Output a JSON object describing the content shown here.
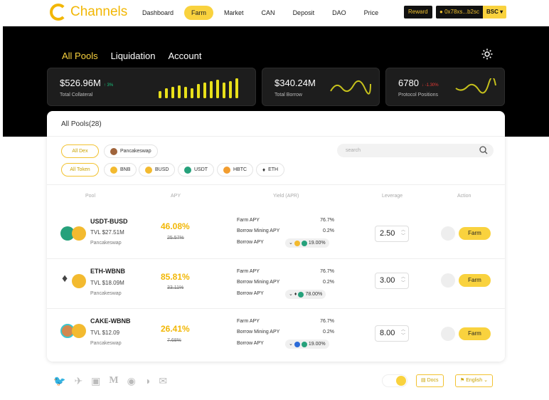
{
  "brand": {
    "name": "Channels"
  },
  "nav": [
    "Dashboard",
    "Farm",
    "Market",
    "CAN",
    "Deposit",
    "DAO",
    "Price"
  ],
  "nav_active": "Farm",
  "header": {
    "reward_label": "Reward",
    "wallet_address": "0x78xs...b2sc",
    "chain": "BSC"
  },
  "tabs": [
    "All Pools",
    "Liquidation",
    "Account"
  ],
  "stats": [
    {
      "value": "$526.96M",
      "label": "Total Collateral",
      "change": "3%",
      "change_dir": "up",
      "color": "#19c37d"
    },
    {
      "value": "$340.24M",
      "label": "Total Borrow"
    },
    {
      "value": "6780",
      "label": "Protocol Positions",
      "change": "-1.30%",
      "change_dir": "down",
      "color": "#e53935"
    }
  ],
  "pools_card": {
    "title": "All Pools(28)"
  },
  "filters": {
    "dex": [
      "All Dex",
      "Pancakeswap"
    ],
    "tokens": [
      "All Token",
      "BNB",
      "BUSD",
      "USDT",
      "HBTC",
      "ETH"
    ],
    "search_placeholder": "search"
  },
  "columns": [
    "Pool",
    "APY",
    "Yield (APR)",
    "Leverage",
    "Action"
  ],
  "rows": [
    {
      "pair": "USDT-BUSD",
      "tvl": "TVL $27.51M",
      "dex": "Pancakeswap",
      "apy": "46.08%",
      "apy_old": "25.57%",
      "farm_apy": "76.7%",
      "borrow_mining_apy": "0.2%",
      "borrow_apy": "19.00%",
      "leverage": "2.50"
    },
    {
      "pair": "ETH-WBNB",
      "tvl": "TVL $18.09M",
      "dex": "Pancakeswap",
      "apy": "85.81%",
      "apy_old": "33.11%",
      "farm_apy": "76.7%",
      "borrow_mining_apy": "0.2%",
      "borrow_apy": "78.00%",
      "leverage": "3.00"
    },
    {
      "pair": "CAKE-WBNB",
      "tvl": "TVL $12.09",
      "dex": "Pancakeswap",
      "apy": "26.41%",
      "apy_old": "7.68%",
      "farm_apy": "76.7%",
      "borrow_mining_apy": "0.2%",
      "borrow_apy": "19.00%",
      "leverage": "8.00"
    }
  ],
  "yield_labels": {
    "farm": "Farm APY",
    "borrow_mining": "Borrow Mining APY",
    "borrow": "Borrow APY"
  },
  "action_label": "Farm",
  "footer": {
    "docs": "Docs",
    "language": "English"
  }
}
